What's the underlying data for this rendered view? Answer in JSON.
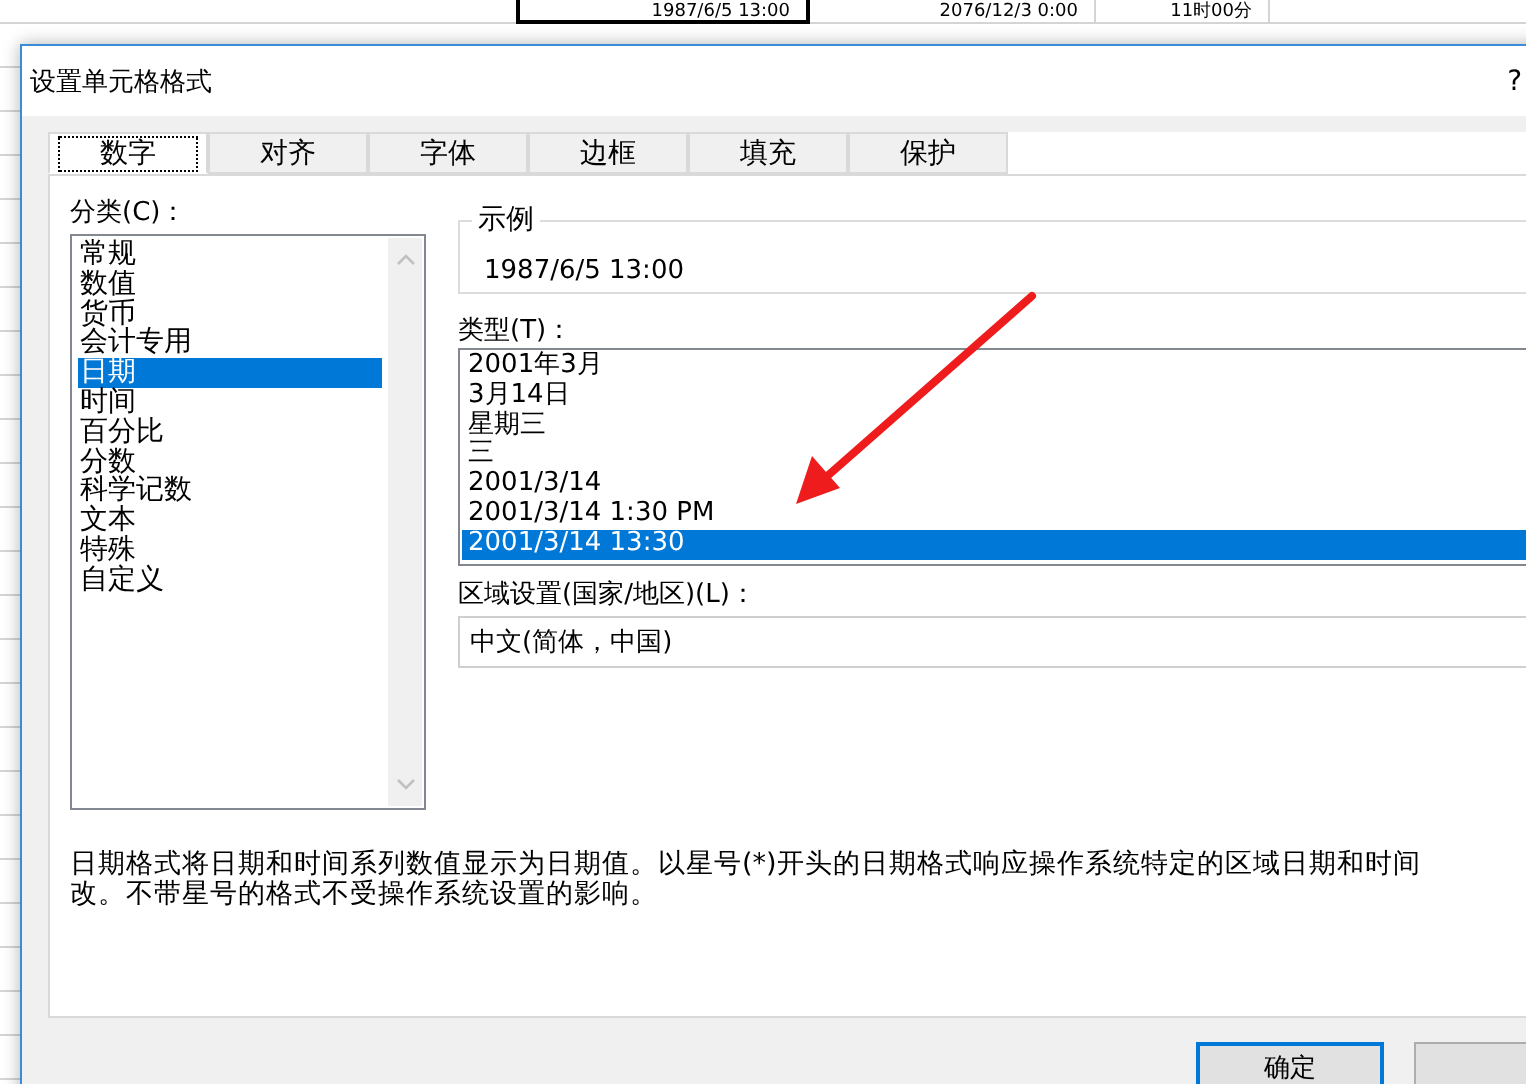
{
  "spreadsheet": {
    "rows": [
      {
        "cells": [
          {
            "text": "1987/6/5 13:00",
            "selected": true
          },
          {
            "text": "2076/12/3 0:00",
            "selected": false
          },
          {
            "text": "11时00分",
            "selected": false
          }
        ]
      }
    ]
  },
  "dialog": {
    "title": "设置单元格格式",
    "help": "?",
    "tabs": [
      {
        "label": "数字",
        "selected": true
      },
      {
        "label": "对齐",
        "selected": false
      },
      {
        "label": "字体",
        "selected": false
      },
      {
        "label": "边框",
        "selected": false
      },
      {
        "label": "填充",
        "selected": false
      },
      {
        "label": "保护",
        "selected": false
      }
    ],
    "category": {
      "label": "分类(C)：",
      "items": [
        {
          "label": "常规",
          "selected": false
        },
        {
          "label": "数值",
          "selected": false
        },
        {
          "label": "货币",
          "selected": false
        },
        {
          "label": "会计专用",
          "selected": false
        },
        {
          "label": "日期",
          "selected": true
        },
        {
          "label": "时间",
          "selected": false
        },
        {
          "label": "百分比",
          "selected": false
        },
        {
          "label": "分数",
          "selected": false
        },
        {
          "label": "科学记数",
          "selected": false
        },
        {
          "label": "文本",
          "selected": false
        },
        {
          "label": "特殊",
          "selected": false
        },
        {
          "label": "自定义",
          "selected": false
        }
      ]
    },
    "sample": {
      "label": "示例",
      "value": "1987/6/5 13:00"
    },
    "type": {
      "label": "类型(T)：",
      "items": [
        {
          "label": "2001年3月",
          "selected": false
        },
        {
          "label": "3月14日",
          "selected": false
        },
        {
          "label": "星期三",
          "selected": false
        },
        {
          "label": "三",
          "selected": false
        },
        {
          "label": "2001/3/14",
          "selected": false
        },
        {
          "label": "2001/3/14 1:30 PM",
          "selected": false
        },
        {
          "label": "2001/3/14 13:30",
          "selected": true
        }
      ]
    },
    "locale": {
      "label": "区域设置(国家/地区)(L)：",
      "value": "中文(简体，中国)"
    },
    "description": [
      "日期格式将日期和时间系列数值显示为日期值。以星号(*)开头的日期格式响应操作系统特定的区域日期和时间",
      "改。不带星号的格式不受操作系统设置的影响。"
    ],
    "buttons": [
      "确定"
    ]
  }
}
